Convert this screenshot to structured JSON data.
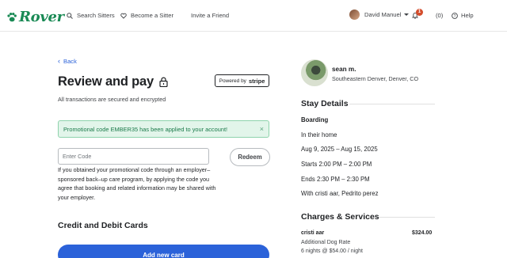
{
  "header": {
    "logo": "Rover",
    "search_sitters": "Search Sitters",
    "become_sitter": "Become a Sitter",
    "invite_friend": "Invite a Friend",
    "user_name": "David Manuel",
    "notification_count": "1",
    "inbox": "(0)",
    "help": "Help"
  },
  "main": {
    "back": "Back",
    "title": "Review and pay",
    "powered_by": "Powered by",
    "stripe": "stripe",
    "secured_note": "All transactions are secured and encrypted",
    "promo_message": "Promotional code EMBER35 has been applied to your account!",
    "promo_close": "×",
    "code_placeholder": "Enter Code",
    "redeem": "Redeem",
    "employer_note": "If you obtained your promotional code through an employer–sponsored back–up care program, by applying the code you agree that booking and related information may be shared with your employer.",
    "cards_heading": "Credit and Debit Cards",
    "add_card": "Add new card"
  },
  "sidebar": {
    "sitter_name": "sean m.",
    "sitter_location": "Southeastern Denver, Denver, CO",
    "stay_heading": "Stay Details",
    "service": "Boarding",
    "location_type": "In their home",
    "dates": "Aug 9, 2025 – Aug 15, 2025",
    "starts": "Starts 2:00 PM – 2:00 PM",
    "ends": "Ends 2:30 PM – 2:30 PM",
    "with": "With cristi aar, Pedrito perez",
    "charges_heading": "Charges & Services",
    "charge_pet": "cristi aar",
    "charge_amount": "$324.00",
    "charge_rate_label": "Additional Dog Rate",
    "charge_rate_detail": "6 nights @ $54.00 / night"
  },
  "colors": {
    "brand_green": "#1a8a55",
    "link_blue": "#2b62d9",
    "success_bg": "#e2f5ea"
  }
}
